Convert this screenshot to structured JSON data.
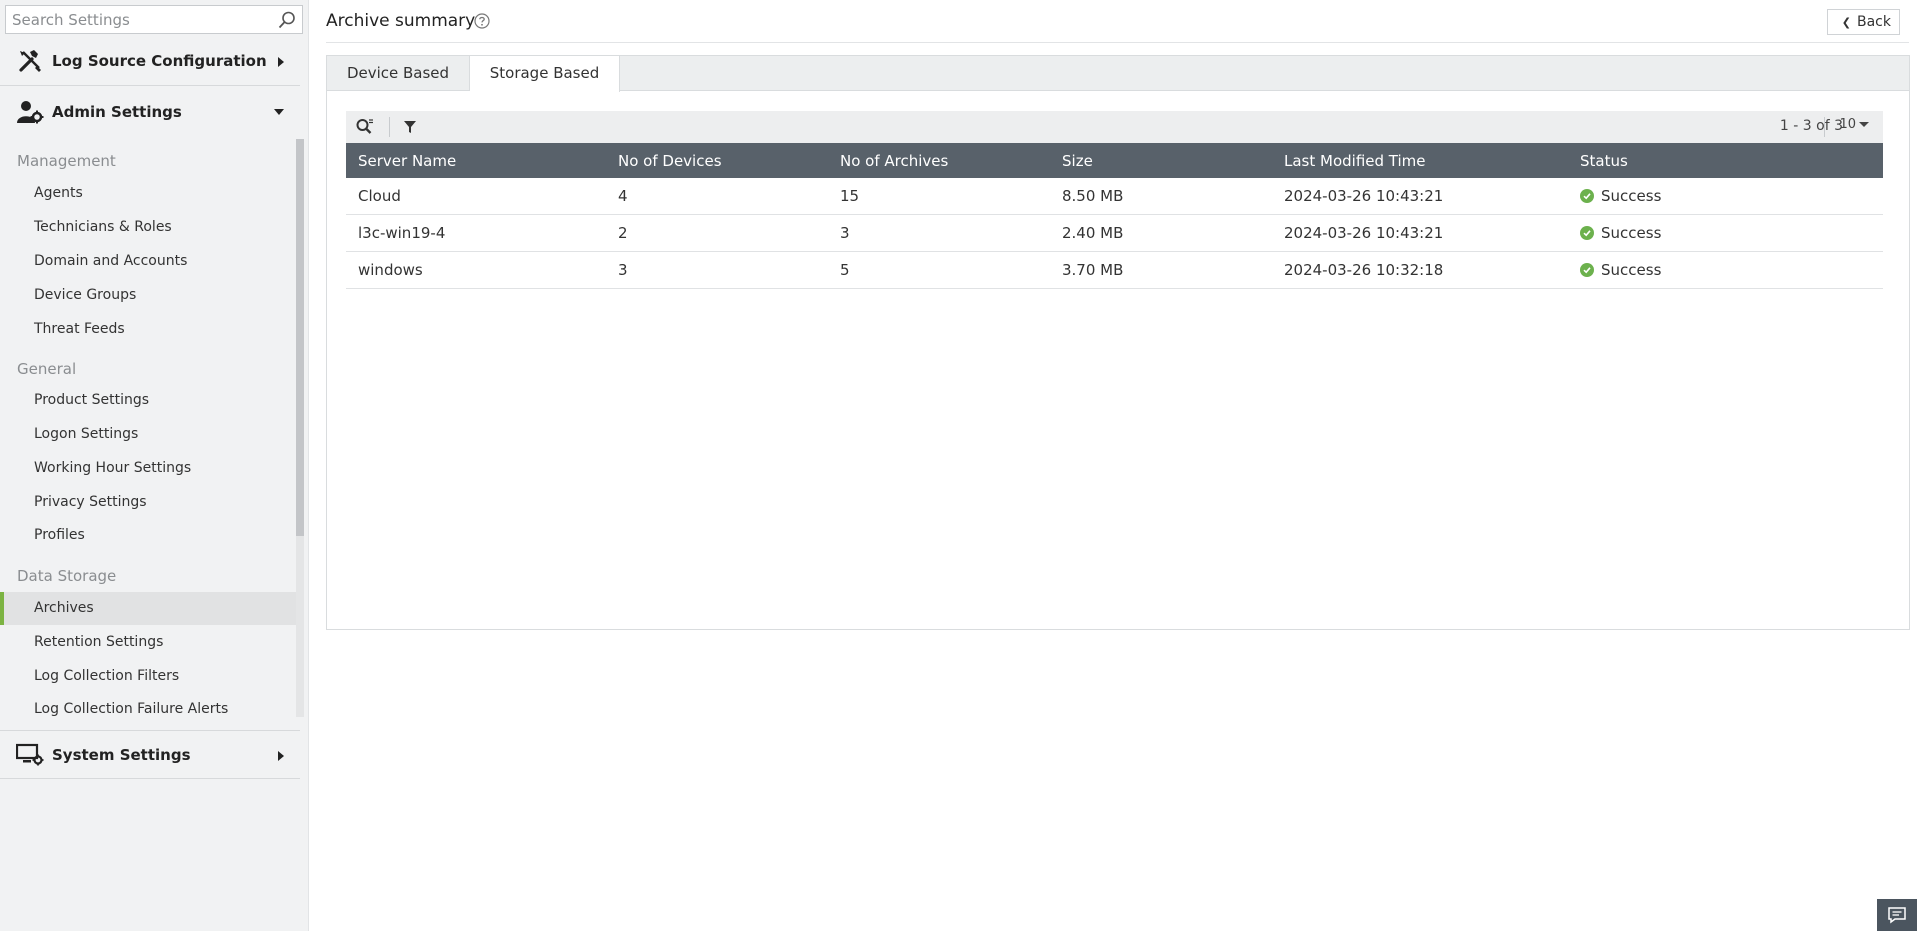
{
  "search": {
    "placeholder": "Search Settings"
  },
  "sidebar": {
    "groups": {
      "log_source": {
        "label": "Log Source Configuration",
        "icon": "tools-icon",
        "expanded": false
      },
      "admin": {
        "label": "Admin Settings",
        "icon": "user-gear-icon",
        "expanded": true
      },
      "system": {
        "label": "System Settings",
        "icon": "monitor-gear-icon",
        "expanded": false
      }
    },
    "sections": [
      {
        "title": "Management",
        "items": [
          "Agents",
          "Technicians & Roles",
          "Domain and Accounts",
          "Device Groups",
          "Threat Feeds"
        ]
      },
      {
        "title": "General",
        "items": [
          "Product Settings",
          "Logon Settings",
          "Working Hour Settings",
          "Privacy Settings",
          "Profiles"
        ]
      },
      {
        "title": "Data Storage",
        "items": [
          "Archives",
          "Retention Settings",
          "Log Collection Filters",
          "Log Collection Failure Alerts"
        ]
      }
    ],
    "active_item": "Archives",
    "accent_color": "#7cb342"
  },
  "header": {
    "title": "Archive summary",
    "back_label": "Back"
  },
  "tabs": [
    {
      "label": "Device Based",
      "active": false
    },
    {
      "label": "Storage Based",
      "active": true
    }
  ],
  "pagination": {
    "range": "1 - 3 of 3",
    "page_size": "10"
  },
  "table": {
    "columns": [
      "Server Name",
      "No of Devices",
      "No of Archives",
      "Size",
      "Last Modified Time",
      "Status"
    ],
    "rows": [
      [
        "Cloud",
        "4",
        "15",
        "8.50 MB",
        "2024-03-26 10:43:21",
        "Success"
      ],
      [
        "l3c-win19-4",
        "2",
        "3",
        "2.40 MB",
        "2024-03-26 10:43:21",
        "Success"
      ],
      [
        "windows",
        "3",
        "5",
        "3.70 MB",
        "2024-03-26 10:32:18",
        "Success"
      ]
    ],
    "header_color": "#58616a",
    "status_color": "#6cb14d"
  }
}
